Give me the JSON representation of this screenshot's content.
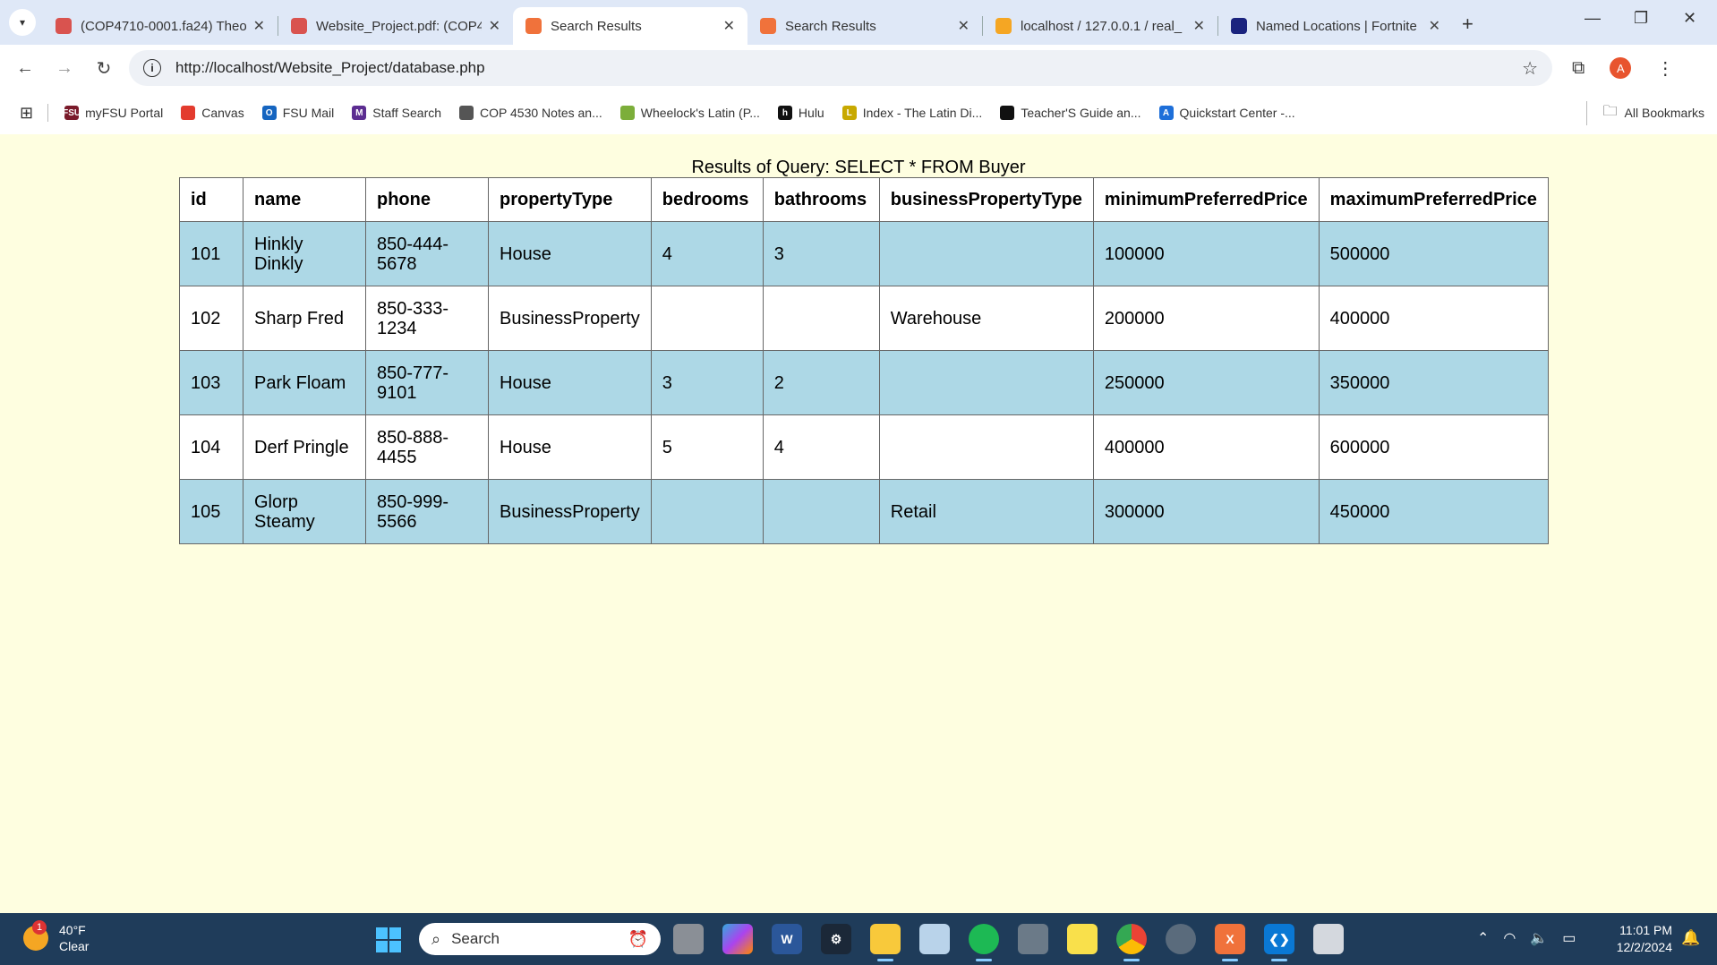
{
  "browser": {
    "tabs": [
      {
        "title": "(COP4710-0001.fa24) Theo",
        "icon_color": "#d9534f",
        "active": false
      },
      {
        "title": "Website_Project.pdf: (COP4",
        "icon_color": "#d9534f",
        "active": false
      },
      {
        "title": "Search Results",
        "icon_color": "#f0723b",
        "active": true
      },
      {
        "title": "Search Results",
        "icon_color": "#f0723b",
        "active": false
      },
      {
        "title": "localhost / 127.0.0.1 / real_",
        "icon_color": "#f5a623",
        "active": false
      },
      {
        "title": "Named Locations | Fortnite",
        "icon_color": "#1a237e",
        "active": false
      }
    ],
    "url": "http://localhost/Website_Project/database.php",
    "profile_initial": "A",
    "bookmarks": [
      {
        "label": "myFSU Portal",
        "icon_text": "FSU",
        "icon_color": "#7a1a2a"
      },
      {
        "label": "Canvas",
        "icon_text": "",
        "icon_color": "#e33b2e"
      },
      {
        "label": "FSU Mail",
        "icon_text": "O",
        "icon_color": "#1565c0"
      },
      {
        "label": "Staff Search",
        "icon_text": "M",
        "icon_color": "#5c2d91"
      },
      {
        "label": "COP 4530 Notes an...",
        "icon_text": "",
        "icon_color": "#555555"
      },
      {
        "label": "Wheelock's Latin (P...",
        "icon_text": "",
        "icon_color": "#7cae3a"
      },
      {
        "label": "Hulu",
        "icon_text": "h",
        "icon_color": "#111111"
      },
      {
        "label": "Index - The Latin Di...",
        "icon_text": "L",
        "icon_color": "#c8a900"
      },
      {
        "label": "Teacher'S Guide an...",
        "icon_text": "",
        "icon_color": "#111111"
      },
      {
        "label": "Quickstart Center -...",
        "icon_text": "A",
        "icon_color": "#1e6fd9"
      }
    ],
    "all_bookmarks": "All Bookmarks"
  },
  "page": {
    "caption": "Results of Query: SELECT * FROM Buyer",
    "columns": [
      "id",
      "name",
      "phone",
      "propertyType",
      "bedrooms",
      "bathrooms",
      "businessPropertyType",
      "minimumPreferredPrice",
      "maximumPreferredPrice"
    ],
    "rows": [
      [
        "101",
        "Hinkly Dinkly",
        "850-444-5678",
        "House",
        "4",
        "3",
        "",
        "100000",
        "500000"
      ],
      [
        "102",
        "Sharp Fred",
        "850-333-1234",
        "BusinessProperty",
        "",
        "",
        "Warehouse",
        "200000",
        "400000"
      ],
      [
        "103",
        "Park Floam",
        "850-777-9101",
        "House",
        "3",
        "2",
        "",
        "250000",
        "350000"
      ],
      [
        "104",
        "Derf Pringle",
        "850-888-4455",
        "House",
        "5",
        "4",
        "",
        "400000",
        "600000"
      ],
      [
        "105",
        "Glorp Steamy",
        "850-999-5566",
        "BusinessProperty",
        "",
        "",
        "Retail",
        "300000",
        "450000"
      ]
    ]
  },
  "taskbar": {
    "weather_temp": "40°F",
    "weather_desc": "Clear",
    "weather_badge": "1",
    "search_placeholder": "Search",
    "time": "11:01 PM",
    "date": "12/2/2024"
  },
  "colors": {
    "page_bg": "#fefee0",
    "row_highlight": "#add8e6",
    "taskbar_bg": "#1f3c5a"
  }
}
